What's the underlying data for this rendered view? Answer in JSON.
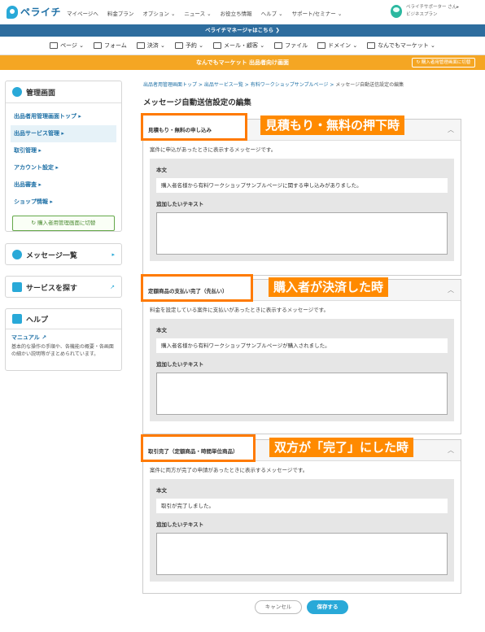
{
  "header": {
    "logo_text": "ペライチ",
    "nav": [
      "マイページへ",
      "料金プラン",
      "オプション ⌄",
      "ニュース ⌄",
      "お役立ち情報",
      "ヘルプ ⌄",
      "サポート/セミナー ⌄"
    ],
    "user_line1": "ペライチサポーター さん▸",
    "user_line2": "ビジネスプラン"
  },
  "notice": "ペライチマネージャはこちら ❯",
  "menubar": [
    "ページ ⌄",
    "フォーム",
    "決済 ⌄",
    "予約 ⌄",
    "メール・顧客 ⌄",
    "ファイル",
    "ドメイン ⌄",
    "なんでもマーケット ⌄"
  ],
  "orangebar": {
    "title": "なんでもマーケット 出品者向け画面",
    "switch_label": "↻ 購入者用管理画面に切替"
  },
  "sidebar": {
    "admin_title": "管理画面",
    "items": [
      "出品者用管理画面トップ ▸",
      "出品サービス管理 ▸",
      "取引管理 ▸",
      "アカウント設定 ▸",
      "出品審査 ▸",
      "ショップ情報 ▸"
    ],
    "switch_button": "↻ 購入者用管理画面に切替",
    "message_title": "メッセージ一覧",
    "message_arrow": "▸",
    "search_title": "サービスを探す",
    "search_arrow": "↗",
    "help_title": "ヘルプ",
    "manual_link": "マニュアル ↗",
    "help_text": "基本的な操作の手順や、各機能の概要・各画面の細かい説明等がまとめられています。"
  },
  "breadcrumb": {
    "items": [
      "出品者用管理画面トップ",
      "出品サービス一覧",
      "有料ワークショップサンプルページ"
    ],
    "sep": " > ",
    "current": "メッセージ自動送信設定の編集"
  },
  "page_title": "メッセージ自動送信設定の編集",
  "panels": [
    {
      "heading": "見積もり・無料の申し込み",
      "callout": "見積もり・無料の押下時",
      "description": "案件に申込があったときに表示するメッセージです。",
      "body_label": "本文",
      "body_text": "購入者名様から有料ワークショップサンプルページに関する申し込みがありました。",
      "extra_label": "追加したいテキスト",
      "chevron": "︿"
    },
    {
      "heading": "定額商品の支払い完了（先払い）",
      "callout": "購入者が決済した時",
      "description": "料金を設定している案件に支払いがあったときに表示するメッセージです。",
      "body_label": "本文",
      "body_text": "購入者名様から有料ワークショップサンプルページが購入されました。",
      "extra_label": "追加したいテキスト",
      "chevron": "︿"
    },
    {
      "heading": "取引完了（定額商品・時間単位商品）",
      "callout": "双方が「完了」にした時",
      "description": "案件に両方が完了の申請があったときに表示するメッセージです。",
      "body_label": "本文",
      "body_text": "取引が完了しました。",
      "extra_label": "追加したいテキスト",
      "chevron": "︿"
    }
  ],
  "buttons": {
    "cancel": "キャンセル",
    "save": "保存する"
  },
  "colors": {
    "accent": "#29a9d8",
    "orange": "#ff8a00",
    "navy": "#2e6d9e"
  }
}
